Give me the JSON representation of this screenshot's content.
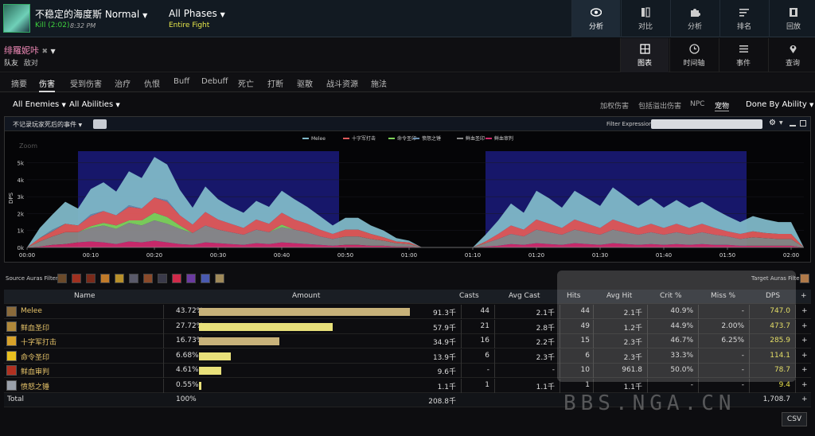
{
  "header": {
    "boss_name": "不稳定的海度斯 Normal",
    "kill": "Kill (2:02)",
    "kill_time": "8:32 PM",
    "phase": "All Phases",
    "fight": "Entire Fight",
    "nav": [
      {
        "label": "分析",
        "icon": "eye-icon",
        "active": true
      },
      {
        "label": "对比",
        "icon": "compare-icon"
      },
      {
        "label": "分析",
        "icon": "puzzle-icon"
      },
      {
        "label": "排名",
        "icon": "ranking-icon"
      },
      {
        "label": "回放",
        "icon": "replay-icon"
      }
    ]
  },
  "player": {
    "name": "绯羅妮咔",
    "friendly": "队友",
    "enemy": "敌对"
  },
  "subnav": [
    {
      "label": "图表",
      "icon": "grid-icon",
      "active": true
    },
    {
      "label": "时间轴",
      "icon": "clock-icon"
    },
    {
      "label": "事件",
      "icon": "list-icon"
    },
    {
      "label": "查询",
      "icon": "pin-icon"
    }
  ],
  "tabs": [
    "摘要",
    "伤害",
    "受到伤害",
    "治疗",
    "仇恨",
    "Buff",
    "Debuff",
    "死亡",
    "打断",
    "驱散",
    "战斗资源",
    "施法"
  ],
  "active_tab": "伤害",
  "filters": {
    "enemies": "All Enemies",
    "abilities": "All Abilities",
    "right": [
      "加权伤害",
      "包括溢出伤害",
      "NPC",
      "宠物"
    ],
    "active_right": "宠物",
    "group_by": "Done By Ability"
  },
  "chart_toolbar": {
    "dead_events": "不记录玩家死后的事件",
    "filter_label": "Filter Expression:"
  },
  "chart_data": {
    "type": "area",
    "ylabel": "DPS",
    "zoom_label": "Zoom",
    "y_ticks": [
      "0k",
      "1k",
      "2k",
      "3k",
      "4k",
      "5k"
    ],
    "ylim": [
      0,
      5500
    ],
    "x_ticks": [
      "00:00",
      "00:10",
      "00:20",
      "00:30",
      "00:40",
      "00:50",
      "01:00",
      "01:10",
      "01:20",
      "01:30",
      "01:40",
      "01:50",
      "02:00"
    ],
    "x_range": [
      0,
      122
    ],
    "highlight_ranges": [
      [
        8,
        49
      ],
      [
        72,
        113
      ]
    ],
    "legend": [
      "Melee",
      "十字军打击",
      "命令圣印",
      "愤怒之锤",
      "鲜血圣印",
      "鲜血审判"
    ],
    "colors": {
      "Melee": "#7fb8c8",
      "十字军打击": "#e05a5a",
      "命令圣印": "#7ed35a",
      "愤怒之锤": "#6a8fb0",
      "鲜血圣印": "#8a8a8a",
      "鲜血审判": "#d02a6a"
    },
    "x": [
      0,
      2,
      4,
      6,
      8,
      10,
      12,
      14,
      16,
      18,
      20,
      22,
      24,
      26,
      28,
      30,
      32,
      34,
      36,
      38,
      40,
      42,
      44,
      46,
      48,
      50,
      52,
      54,
      56,
      58,
      60,
      62,
      64,
      66,
      68,
      70,
      72,
      74,
      76,
      78,
      80,
      82,
      84,
      86,
      88,
      90,
      92,
      94,
      96,
      98,
      100,
      102,
      104,
      106,
      108,
      110,
      112,
      114,
      116,
      118,
      120,
      122
    ],
    "series": [
      {
        "name": "鲜血审判",
        "values": [
          0,
          50,
          150,
          200,
          300,
          350,
          300,
          200,
          350,
          300,
          400,
          300,
          200,
          150,
          300,
          250,
          200,
          150,
          250,
          200,
          300,
          250,
          200,
          150,
          100,
          150,
          150,
          100,
          100,
          50,
          50,
          0,
          0,
          0,
          0,
          0,
          50,
          100,
          200,
          150,
          250,
          200,
          150,
          250,
          200,
          150,
          250,
          200,
          150,
          200,
          150,
          200,
          150,
          200,
          150,
          150,
          100,
          100,
          100,
          100,
          100,
          0
        ]
      },
      {
        "name": "鲜血圣印",
        "values": [
          0,
          300,
          500,
          700,
          600,
          800,
          1000,
          900,
          1100,
          1000,
          1200,
          1100,
          900,
          700,
          1000,
          800,
          700,
          600,
          800,
          700,
          900,
          800,
          700,
          500,
          400,
          500,
          500,
          400,
          300,
          200,
          150,
          0,
          0,
          0,
          0,
          0,
          200,
          400,
          600,
          500,
          800,
          700,
          600,
          800,
          700,
          600,
          800,
          700,
          600,
          700,
          600,
          700,
          600,
          700,
          600,
          500,
          400,
          500,
          450,
          400,
          400,
          0
        ]
      },
      {
        "name": "命令圣印",
        "values": [
          0,
          0,
          0,
          0,
          0,
          100,
          150,
          200,
          150,
          300,
          450,
          400,
          200,
          0,
          0,
          0,
          0,
          0,
          0,
          0,
          150,
          0,
          0,
          0,
          0,
          0,
          0,
          0,
          0,
          0,
          0,
          0,
          0,
          0,
          0,
          0,
          0,
          0,
          0,
          0,
          0,
          0,
          0,
          0,
          0,
          0,
          0,
          0,
          0,
          0,
          0,
          0,
          0,
          0,
          0,
          0,
          0,
          0,
          0,
          0,
          0,
          0
        ]
      },
      {
        "name": "十字军打击",
        "values": [
          0,
          200,
          300,
          500,
          400,
          600,
          700,
          600,
          800,
          700,
          900,
          900,
          600,
          500,
          800,
          600,
          500,
          400,
          600,
          500,
          700,
          600,
          500,
          400,
          300,
          400,
          400,
          300,
          200,
          100,
          100,
          0,
          0,
          0,
          0,
          0,
          100,
          300,
          500,
          400,
          600,
          500,
          400,
          600,
          500,
          400,
          600,
          500,
          400,
          500,
          400,
          500,
          400,
          500,
          400,
          300,
          300,
          350,
          300,
          300,
          300,
          0
        ]
      },
      {
        "name": "愤怒之锤",
        "values": [
          0,
          0,
          100,
          0,
          0,
          100,
          0,
          0,
          100,
          0,
          0,
          100,
          0,
          0,
          0,
          0,
          0,
          0,
          0,
          0,
          0,
          0,
          0,
          0,
          0,
          0,
          0,
          0,
          0,
          0,
          0,
          0,
          0,
          0,
          0,
          0,
          0,
          0,
          0,
          0,
          0,
          0,
          0,
          0,
          0,
          0,
          0,
          0,
          0,
          0,
          0,
          0,
          0,
          0,
          0,
          0,
          0,
          0,
          0,
          0,
          0,
          0
        ]
      },
      {
        "name": "Melee",
        "values": [
          0,
          600,
          900,
          1300,
          1000,
          1500,
          1700,
          1400,
          2000,
          1800,
          2400,
          2100,
          1500,
          1000,
          1500,
          1200,
          1000,
          900,
          1100,
          1000,
          1300,
          1200,
          1000,
          800,
          500,
          700,
          700,
          500,
          400,
          200,
          100,
          0,
          0,
          0,
          0,
          0,
          400,
          800,
          1300,
          1000,
          1700,
          1500,
          1200,
          1700,
          1500,
          1300,
          1900,
          1600,
          1300,
          1500,
          1200,
          1400,
          1200,
          1300,
          1100,
          900,
          700,
          900,
          800,
          700,
          700,
          0
        ]
      }
    ]
  },
  "auras": {
    "source_label": "Source Auras Filter:",
    "target_label": "Target Auras Filter:"
  },
  "table": {
    "headers": [
      "Name",
      "Amount",
      "Casts",
      "Avg Cast",
      "Hits",
      "Avg Hit",
      "Crit %",
      "Miss %",
      "DPS",
      "+"
    ],
    "rows": [
      {
        "name": "Melee",
        "pct": "43.72%",
        "pct_value": 43.72,
        "amount": "91.3千",
        "casts": "44",
        "avg_cast": "2.1千",
        "hits": "44",
        "avg_hit": "2.1千",
        "crit": "40.9%",
        "miss": "-",
        "dps": "747.0",
        "plus": "+",
        "bar_color": "#c8b27a",
        "icon": "melee-icon",
        "icon_color": "#8a6a3a"
      },
      {
        "name": "鲜血圣印",
        "pct": "27.72%",
        "pct_value": 27.72,
        "amount": "57.9千",
        "casts": "21",
        "avg_cast": "2.8千",
        "hits": "49",
        "avg_hit": "1.2千",
        "crit": "44.9%",
        "miss": "2.00%",
        "dps": "473.7",
        "plus": "+",
        "bar_color": "#e8e07a",
        "icon": "seal-of-blood-icon",
        "icon_color": "#b0883a"
      },
      {
        "name": "十字军打击",
        "pct": "16.73%",
        "pct_value": 16.73,
        "amount": "34.9千",
        "casts": "16",
        "avg_cast": "2.2千",
        "hits": "15",
        "avg_hit": "2.3千",
        "crit": "46.7%",
        "miss": "6.25%",
        "dps": "285.9",
        "plus": "+",
        "bar_color": "#c8b27a",
        "icon": "crusader-strike-icon",
        "icon_color": "#d8a22a"
      },
      {
        "name": "命令圣印",
        "pct": "6.68%",
        "pct_value": 6.68,
        "amount": "13.9千",
        "casts": "6",
        "avg_cast": "2.3千",
        "hits": "6",
        "avg_hit": "2.3千",
        "crit": "33.3%",
        "miss": "-",
        "dps": "114.1",
        "plus": "+",
        "bar_color": "#e8e07a",
        "icon": "seal-of-command-icon",
        "icon_color": "#e8c020"
      },
      {
        "name": "鲜血审判",
        "pct": "4.61%",
        "pct_value": 4.61,
        "amount": "9.6千",
        "casts": "-",
        "avg_cast": "-",
        "hits": "10",
        "avg_hit": "961.8",
        "crit": "50.0%",
        "miss": "-",
        "dps": "78.7",
        "plus": "+",
        "bar_color": "#e8e07a",
        "icon": "judgement-of-blood-icon",
        "icon_color": "#b03020"
      },
      {
        "name": "愤怒之锤",
        "pct": "0.55%",
        "pct_value": 0.55,
        "amount": "1.1千",
        "casts": "1",
        "avg_cast": "1.1千",
        "hits": "1",
        "avg_hit": "1.1千",
        "crit": "-",
        "miss": "-",
        "dps": "9.4",
        "plus": "+",
        "bar_color": "#e8e07a",
        "icon": "hammer-of-wrath-icon",
        "icon_color": "#9aa0aa"
      }
    ],
    "total": {
      "name": "Total",
      "pct": "100%",
      "amount": "208.8千",
      "dps": "1,708.7",
      "plus": "+"
    }
  },
  "csv_label": "CSV",
  "watermark": "BBS.NGA.CN"
}
